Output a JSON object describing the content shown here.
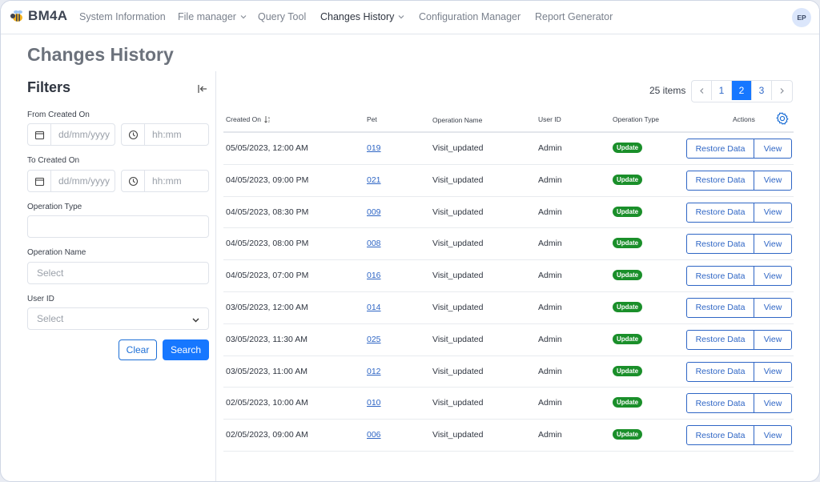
{
  "app": {
    "name": "BM4A"
  },
  "nav": {
    "items": [
      {
        "label": "System Information",
        "dropdown": false,
        "active": false
      },
      {
        "label": "File manager",
        "dropdown": true,
        "active": false
      },
      {
        "label": "Query Tool",
        "dropdown": false,
        "active": false
      },
      {
        "label": "Changes History",
        "dropdown": true,
        "active": true
      },
      {
        "label": "Configuration Manager",
        "dropdown": false,
        "active": false
      },
      {
        "label": "Report Generator",
        "dropdown": false,
        "active": false
      }
    ],
    "user_initials": "EP"
  },
  "page": {
    "title": "Changes History"
  },
  "filters": {
    "title": "Filters",
    "from_label": "From Created On",
    "to_label": "To Created On",
    "date_placeholder": "dd/mm/yyyy",
    "time_placeholder": "hh:mm",
    "operation_type_label": "Operation Type",
    "operation_type_value": "",
    "operation_name_label": "Operation Name",
    "operation_name_placeholder": "Select",
    "user_id_label": "User ID",
    "user_id_placeholder": "Select",
    "clear_label": "Clear",
    "search_label": "Search"
  },
  "results": {
    "items_count": "25 items",
    "pages": [
      "1",
      "2",
      "3"
    ],
    "current_page": "2",
    "columns": {
      "created_on": "Created On",
      "pet": "Pet",
      "operation_name": "Operation Name",
      "user_id": "User ID",
      "operation_type": "Operation Type",
      "actions": "Actions"
    },
    "restore_label": "Restore Data",
    "view_label": "View",
    "rows": [
      {
        "created_on": "05/05/2023, 12:00 AM",
        "pet": "019",
        "operation_name": "Visit_updated",
        "user_id": "Admin",
        "operation_type": "Update"
      },
      {
        "created_on": "04/05/2023, 09:00 PM",
        "pet": "021",
        "operation_name": "Visit_updated",
        "user_id": "Admin",
        "operation_type": "Update"
      },
      {
        "created_on": "04/05/2023, 08:30 PM",
        "pet": "009",
        "operation_name": "Visit_updated",
        "user_id": "Admin",
        "operation_type": "Update"
      },
      {
        "created_on": "04/05/2023, 08:00 PM",
        "pet": "008",
        "operation_name": "Visit_updated",
        "user_id": "Admin",
        "operation_type": "Update"
      },
      {
        "created_on": "04/05/2023, 07:00 PM",
        "pet": "016",
        "operation_name": "Visit_updated",
        "user_id": "Admin",
        "operation_type": "Update"
      },
      {
        "created_on": "03/05/2023, 12:00 AM",
        "pet": "014",
        "operation_name": "Visit_updated",
        "user_id": "Admin",
        "operation_type": "Update"
      },
      {
        "created_on": "03/05/2023, 11:30 AM",
        "pet": "025",
        "operation_name": "Visit_updated",
        "user_id": "Admin",
        "operation_type": "Update"
      },
      {
        "created_on": "03/05/2023, 11:00 AM",
        "pet": "012",
        "operation_name": "Visit_updated",
        "user_id": "Admin",
        "operation_type": "Update"
      },
      {
        "created_on": "02/05/2023, 10:00 AM",
        "pet": "010",
        "operation_name": "Visit_updated",
        "user_id": "Admin",
        "operation_type": "Update"
      },
      {
        "created_on": "02/05/2023, 09:00 AM",
        "pet": "006",
        "operation_name": "Visit_updated",
        "user_id": "Admin",
        "operation_type": "Update"
      }
    ]
  },
  "icons": {
    "logo": "bee-logo-icon",
    "calendar": "calendar-icon",
    "clock": "clock-icon",
    "collapse": "collapse-left-icon",
    "settings": "gear-icon",
    "sort": "sort-icon"
  },
  "colors": {
    "primary": "#1677ff",
    "link": "#2f66c5",
    "badge": "#1a8f2a"
  }
}
